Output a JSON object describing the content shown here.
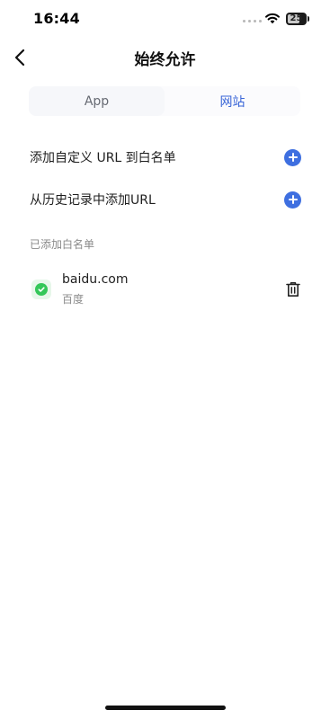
{
  "status_bar": {
    "time": "16:44",
    "battery_level": "25",
    "icons": [
      "signal-dots-icon",
      "wifi-icon",
      "battery-icon"
    ]
  },
  "nav": {
    "title": "始终允许",
    "back_icon": "chevron-left-icon"
  },
  "tabs": [
    {
      "label": "App",
      "selected": false
    },
    {
      "label": "网站",
      "selected": true
    }
  ],
  "actions": [
    {
      "label": "添加自定义 URL 到白名单",
      "icon": "plus-circle-icon"
    },
    {
      "label": "从历史记录中添加URL",
      "icon": "plus-circle-icon"
    }
  ],
  "whitelist": {
    "section_title": "已添加白名单",
    "items": [
      {
        "domain": "baidu.com",
        "name": "百度",
        "status_icon": "check-circle-icon",
        "action_icon": "trash-icon"
      }
    ]
  },
  "colors": {
    "accent": "#3e6fe0",
    "tab_active": "#3a66d8",
    "success": "#34c759"
  }
}
